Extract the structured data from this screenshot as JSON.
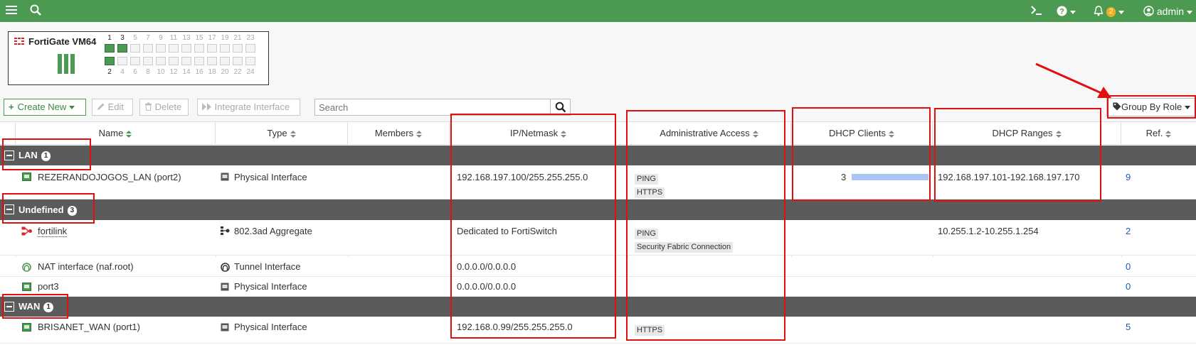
{
  "header": {
    "user": "admin",
    "notification_count": "2"
  },
  "device": {
    "name": "FortiGate VM64",
    "ports_top": [
      "1",
      "3",
      "5",
      "7",
      "9",
      "11",
      "13",
      "15",
      "17",
      "19",
      "21",
      "23"
    ],
    "ports_bottom": [
      "2",
      "4",
      "6",
      "8",
      "10",
      "12",
      "14",
      "16",
      "18",
      "20",
      "22",
      "24"
    ],
    "active_ports": [
      "1",
      "2",
      "3"
    ]
  },
  "toolbar": {
    "create_new": "Create New",
    "edit": "Edit",
    "delete": "Delete",
    "integrate": "Integrate Interface",
    "search_placeholder": "Search",
    "group_by": "Group By Role"
  },
  "columns": [
    "Name",
    "Type",
    "Members",
    "IP/Netmask",
    "Administrative Access",
    "DHCP Clients",
    "DHCP Ranges",
    "Ref."
  ],
  "groups": [
    {
      "name": "LAN",
      "count": "1"
    },
    {
      "name": "Undefined",
      "count": "3"
    },
    {
      "name": "WAN",
      "count": "1"
    }
  ],
  "rows": [
    {
      "name": "REZERANDOJOGOS_LAN (port2)",
      "type": "Physical Interface",
      "ip": "192.168.197.100/255.255.255.0",
      "access": [
        "PING",
        "HTTPS"
      ],
      "dhcp_clients": "3",
      "dhcp_ranges": "192.168.197.101-192.168.197.170",
      "ref": "9"
    },
    {
      "name": "fortilink",
      "type": "802.3ad Aggregate",
      "ip": "Dedicated to FortiSwitch",
      "access": [
        "PING",
        "Security Fabric Connection"
      ],
      "dhcp_clients": "",
      "dhcp_ranges": "10.255.1.2-10.255.1.254",
      "ref": "2"
    },
    {
      "name": "NAT interface (naf.root)",
      "type": "Tunnel Interface",
      "ip": "0.0.0.0/0.0.0.0",
      "access": [],
      "dhcp_clients": "",
      "dhcp_ranges": "",
      "ref": "0"
    },
    {
      "name": "port3",
      "type": "Physical Interface",
      "ip": "0.0.0.0/0.0.0.0",
      "access": [],
      "dhcp_clients": "",
      "dhcp_ranges": "",
      "ref": "0"
    },
    {
      "name": "BRISANET_WAN (port1)",
      "type": "Physical Interface",
      "ip": "192.168.0.99/255.255.255.0",
      "access": [
        "HTTPS"
      ],
      "dhcp_clients": "",
      "dhcp_ranges": "",
      "ref": "5"
    }
  ],
  "colors": {
    "header_green": "#4c9a51",
    "group_row": "#5b5b5b",
    "annotation_red": "#e01010",
    "dhcp_bar": "#a9c4f5",
    "link_blue": "#1a5bb4"
  }
}
